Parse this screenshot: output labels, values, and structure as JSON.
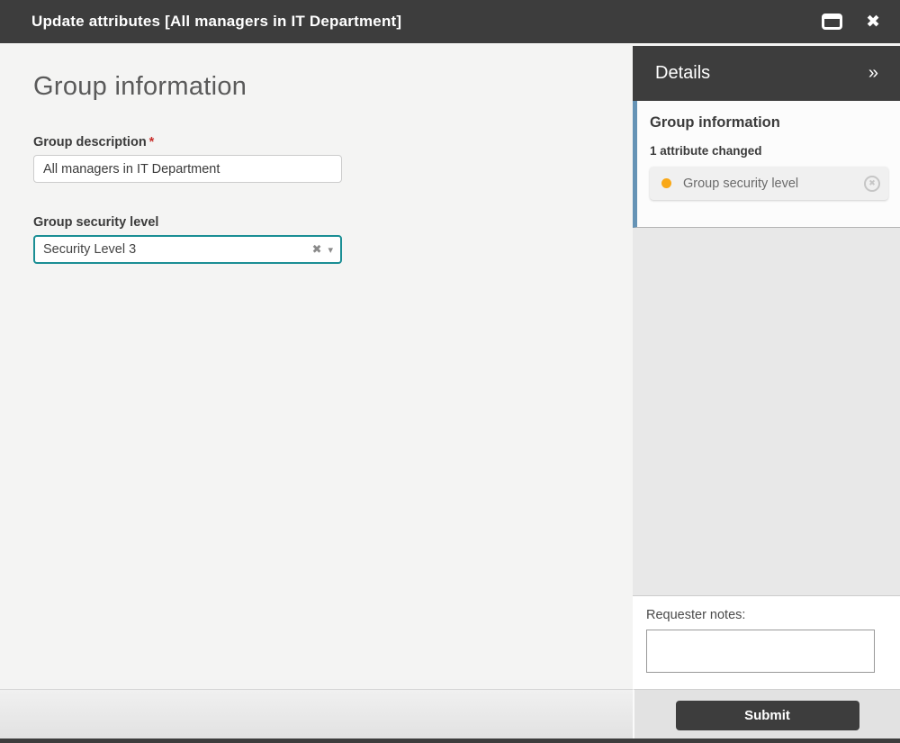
{
  "titlebar": {
    "title": "Update attributes [All managers in IT Department]",
    "icons": {
      "maximize": "window-maximize",
      "close": "✖"
    }
  },
  "main": {
    "heading": "Group information",
    "fields": [
      {
        "label": "Group description",
        "required_marker": "*",
        "value": "All managers in IT Department",
        "type": "text"
      },
      {
        "label": "Group security level",
        "value": "Security Level 3",
        "type": "dropdown",
        "border_color": "#1a8e94",
        "icons": {
          "clear": "✖",
          "caret": "▾"
        }
      }
    ]
  },
  "details": {
    "header": "Details",
    "collapse_icon": "»",
    "section_title": "Group information",
    "change_summary": "1 attribute changed",
    "changed_attribute": {
      "label": "Group security level",
      "dot_color": "#f9a817",
      "revert_icon": "✖"
    },
    "section_border_color": "#6593b5"
  },
  "notes": {
    "label": "Requester notes:",
    "value": ""
  },
  "footer": {
    "submit_label": "Submit"
  },
  "colors": {
    "titlebar_bg": "#3d3d3d",
    "left_bg": "#f4f4f3",
    "right_filler_bg": "#e8e8e8",
    "accent_teal": "#1a8e94",
    "required_red": "#c9302c"
  }
}
